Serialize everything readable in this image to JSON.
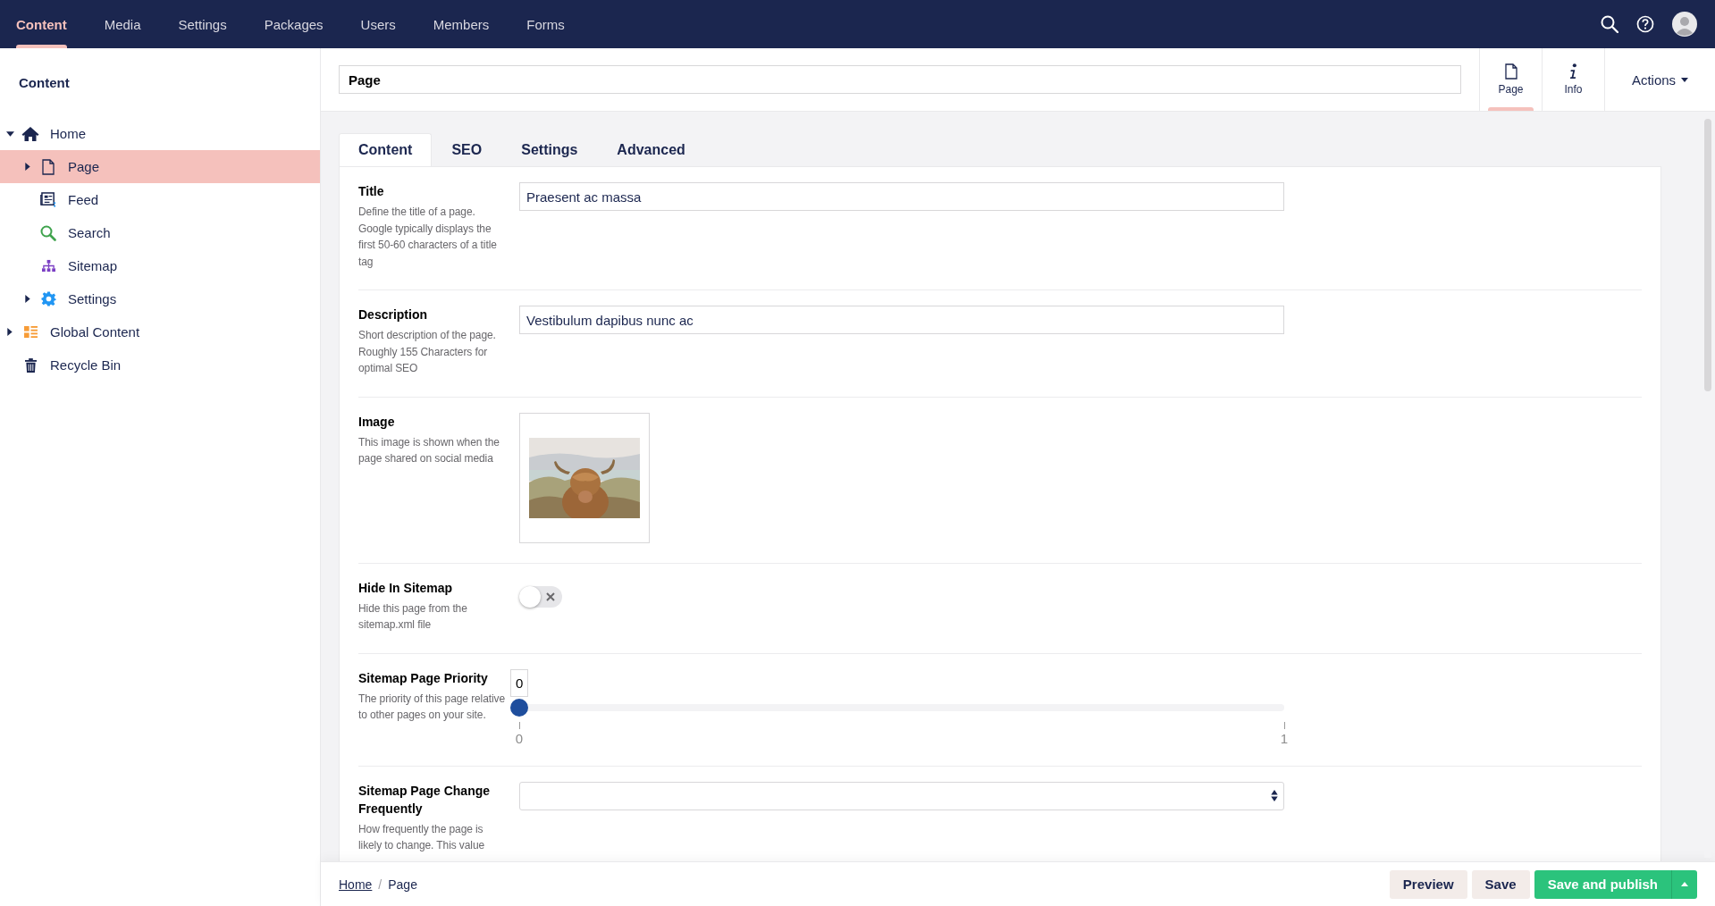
{
  "topnav": {
    "items": [
      {
        "label": "Content",
        "selected": true
      },
      {
        "label": "Media",
        "selected": false
      },
      {
        "label": "Settings",
        "selected": false
      },
      {
        "label": "Packages",
        "selected": false
      },
      {
        "label": "Users",
        "selected": false
      },
      {
        "label": "Members",
        "selected": false
      },
      {
        "label": "Forms",
        "selected": false
      }
    ]
  },
  "sidebar": {
    "title": "Content",
    "tree": [
      {
        "label": "Home",
        "selected": false,
        "expanded": true,
        "children": [
          {
            "label": "Page",
            "selected": true,
            "expanded": false
          },
          {
            "label": "Feed",
            "selected": false
          },
          {
            "label": "Search",
            "selected": false
          },
          {
            "label": "Sitemap",
            "selected": false
          },
          {
            "label": "Settings",
            "selected": false,
            "expanded": false
          }
        ]
      },
      {
        "label": "Global Content",
        "selected": false,
        "expanded": false
      },
      {
        "label": "Recycle Bin",
        "selected": false
      }
    ]
  },
  "editor": {
    "name": "Page",
    "apps": [
      {
        "label": "Page",
        "selected": true
      },
      {
        "label": "Info",
        "selected": false
      }
    ],
    "actions": "Actions"
  },
  "tabs": [
    {
      "label": "Content",
      "selected": true
    },
    {
      "label": "SEO",
      "selected": false
    },
    {
      "label": "Settings",
      "selected": false
    },
    {
      "label": "Advanced",
      "selected": false
    }
  ],
  "properties": [
    {
      "kind": "text",
      "label": "Title",
      "description": "Define the title of a page. Google typically displays the first 50-60 characters of a title tag",
      "value": "Praesent ac massa"
    },
    {
      "kind": "text",
      "label": "Description",
      "description": "Short description of the page. Roughly 155 Characters for optimal SEO",
      "value": "Vestibulum dapibus nunc ac"
    },
    {
      "label": "Image",
      "description": "This image is shown when the page shared on social media"
    },
    {
      "kind": "toggle",
      "label": "Hide In Sitemap",
      "description": "Hide this page from the sitemap.xml file",
      "on": false
    },
    {
      "kind": "slider",
      "label": "Sitemap Page Priority",
      "description": "The priority of this page relative to other pages on your site.",
      "reading": "0",
      "level": 0,
      "min_label": "0",
      "max_label": "1"
    },
    {
      "kind": "select",
      "label": "Sitemap Page Change Frequently",
      "description": "How frequently the page is likely to change. This value"
    }
  ],
  "breadcrumb": {
    "separator": "/",
    "items": [
      {
        "label": "Home",
        "link": true
      },
      {
        "label": "Page",
        "link": false
      }
    ]
  },
  "buttons": [
    {
      "label": "Preview",
      "kind": "secondary"
    },
    {
      "label": "Save",
      "kind": "secondary"
    },
    {
      "label": "Save and publish",
      "kind": "primary"
    }
  ]
}
